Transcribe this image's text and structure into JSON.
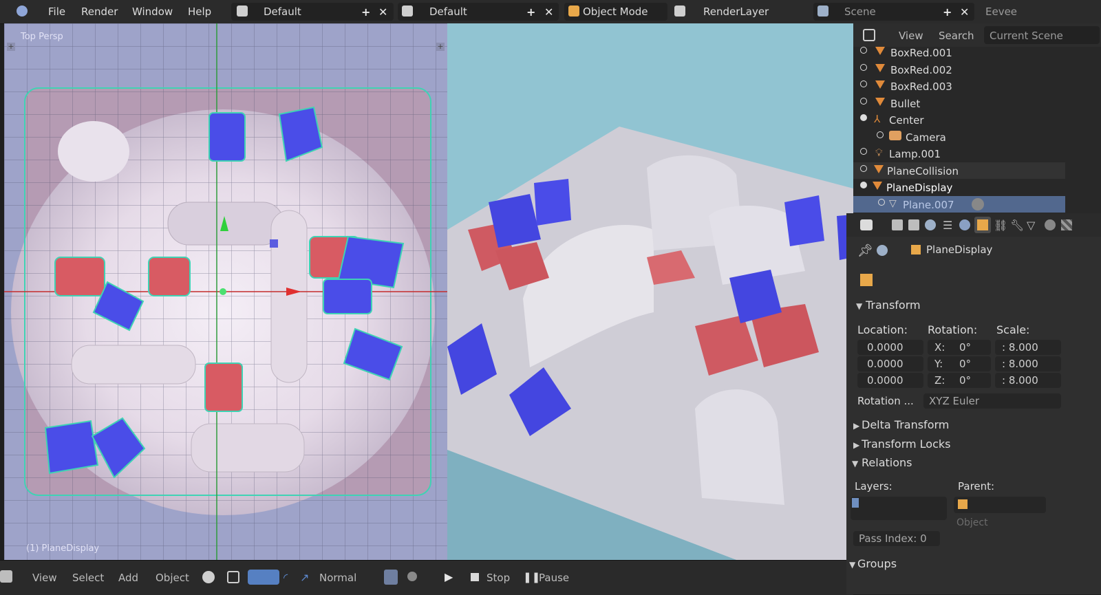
{
  "topbar": {
    "menu": [
      "File",
      "Render",
      "Window",
      "Help"
    ],
    "screen_layout": "Default",
    "workspace": "Default",
    "mode": "Object Mode",
    "render_layer": "RenderLayer",
    "scene": "Scene",
    "engine": "Eevee"
  },
  "viewport_left": {
    "label": "Top Persp",
    "object_label": "(1) PlaneDisplay"
  },
  "bottombar": {
    "menu": [
      "View",
      "Select",
      "Add",
      "Object"
    ],
    "shading": "Normal",
    "stop": "Stop",
    "pause": "Pause"
  },
  "outliner": {
    "tabs": [
      "View",
      "Search",
      "Current Scene"
    ],
    "items": [
      {
        "name": "BoxRed.001"
      },
      {
        "name": "BoxRed.002"
      },
      {
        "name": "BoxRed.003"
      },
      {
        "name": "Bullet"
      },
      {
        "name": "Center"
      },
      {
        "name": "Camera"
      },
      {
        "name": "Lamp.001"
      },
      {
        "name": "PlaneCollision"
      },
      {
        "name": "PlaneDisplay"
      },
      {
        "name": "Plane.007"
      }
    ]
  },
  "properties": {
    "object_name": "PlaneDisplay",
    "transform_title": "Transform",
    "location_label": "Location:",
    "rotation_label": "Rotation:",
    "scale_label": "Scale:",
    "location": [
      "0.0000",
      "0.0000",
      "0.0000"
    ],
    "rotation_axes": [
      "X:",
      "Y:",
      "Z:"
    ],
    "rotation": [
      "0°",
      "0°",
      "0°"
    ],
    "scale": [
      ": 8.000",
      ": 8.000",
      ": 8.000"
    ],
    "rotation_mode_label": "Rotation ...",
    "rotation_mode": "XYZ Euler",
    "delta_transform": "Delta Transform",
    "transform_locks": "Transform Locks",
    "relations": "Relations",
    "layers_label": "Layers:",
    "parent_label": "Parent:",
    "parent_field": "Object",
    "pass_index": "Pass Index:  0",
    "groups": "Groups"
  }
}
